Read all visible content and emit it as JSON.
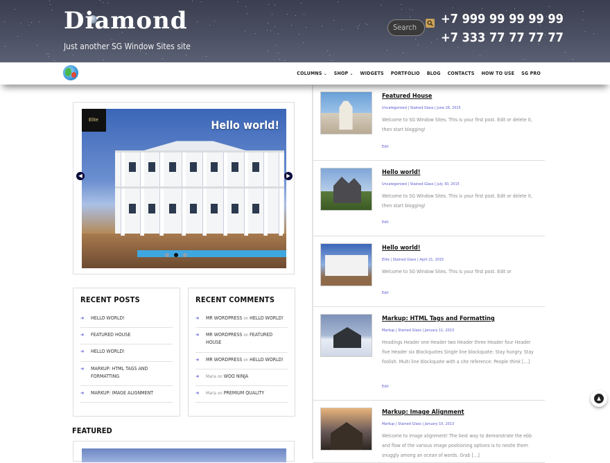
{
  "header": {
    "site_title": "Diamond",
    "tagline": "Just another SG Window Sites site",
    "search_placeholder": "Search",
    "phones": [
      "+7 999 99 99 99 99",
      "+7 333 77 77 77 77"
    ]
  },
  "nav": {
    "items": [
      {
        "label": "COLUMNS",
        "dropdown": true
      },
      {
        "label": "SHOP",
        "dropdown": true
      },
      {
        "label": "WIDGETS",
        "dropdown": false
      },
      {
        "label": "PORTFOLIO",
        "dropdown": false
      },
      {
        "label": "BLOG",
        "dropdown": false
      },
      {
        "label": "CONTACTS",
        "dropdown": false
      },
      {
        "label": "HOW TO USE",
        "dropdown": false
      },
      {
        "label": "SG PRO",
        "dropdown": false
      }
    ]
  },
  "slider": {
    "tag": "Elite",
    "title": "Hello world!",
    "dot_count": 3,
    "active_dot": 1
  },
  "recent_posts": {
    "title": "RECENT POSTS",
    "items": [
      "HELLO WORLD!",
      "FEATURED HOUSE",
      "HELLO WORLD!",
      "MARKUP: HTML TAGS AND FORMATTING",
      "MARKUP: IMAGE ALIGNMENT"
    ]
  },
  "recent_comments": {
    "title": "RECENT COMMENTS",
    "items": [
      {
        "author": "MR WORDPRESS",
        "on": "on",
        "post": "HELLO WORLD!"
      },
      {
        "author": "MR WORDPRESS",
        "on": "on",
        "post": "FEATURED HOUSE"
      },
      {
        "author": "MR WORDPRESS",
        "on": "on",
        "post": "HELLO WORLD!"
      },
      {
        "author": "Maria",
        "on": "on",
        "post": "WOO NINJA"
      },
      {
        "author": "Maria",
        "on": "on",
        "post": "PREMIUM QUALITY"
      }
    ]
  },
  "featured": {
    "title": "FEATURED"
  },
  "posts": [
    {
      "title": "Featured House",
      "meta": "Uncategorized  |  Stained Glass  |  June 26, 2015",
      "excerpt": "Welcome to SG Window Sites. This is your first post. Edit or delete it, then start blogging!",
      "edit": "Edit"
    },
    {
      "title": "Hello world!",
      "meta": "Uncategorized  |  Stained Glass  |  July 30, 2015",
      "excerpt": "Welcome to SG Window Sites. This is your first post. Edit or delete it, then start blogging!",
      "edit": "Edit"
    },
    {
      "title": "Hello world!",
      "meta": "Elite  |  Stained Glass  |  April 21, 2015",
      "excerpt": "Welcome to SG Window Sites. This is your first post. Edit or",
      "edit": "Edit"
    },
    {
      "title": "Markup: HTML Tags and Formatting",
      "meta": "Markup  |  Stained Glass  |  January 11, 2013",
      "excerpt": "Headings Header one Header two Header three Header four Header five Header six Blockquotes Single line blockquote: Stay hungry. Stay foolish. Multi line blockquote with a cite reference: People think […]",
      "edit": "Edit"
    },
    {
      "title": "Markup: Image Alignment",
      "meta": "Markup  |  Stained Glass  |  January 10, 2013",
      "excerpt": "Welcome to image alignment! The best way to demonstrate the ebb and flow of the various image positioning options is to nestle them snuggly among an ocean of words. Grab […]",
      "edit": ""
    }
  ]
}
